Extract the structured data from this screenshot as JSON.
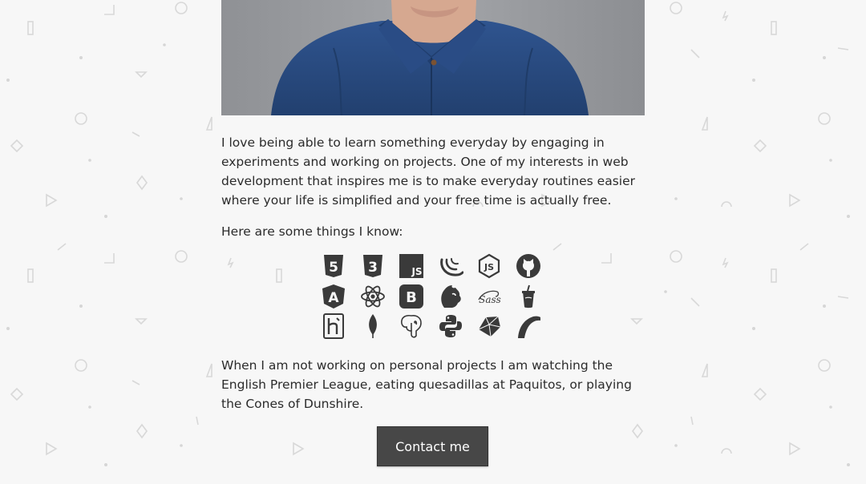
{
  "about": {
    "paragraph_1": "I love being able to learn something everyday by engaging in experiments and working on projects. One of my interests in web development that inspires me is to make everyday routines easier where your life is simplified and your free time is actually free.",
    "skills_intro": "Here are some things I know:",
    "paragraph_2": "When I am not working on personal projects I am watching the English Premier League, eating quesadillas at Paquitos, or playing the Cones of Dunshire."
  },
  "skills": [
    {
      "icon": "html5-icon"
    },
    {
      "icon": "css3-icon"
    },
    {
      "icon": "javascript-icon",
      "text": "JS"
    },
    {
      "icon": "jquery-icon"
    },
    {
      "icon": "nodejs-icon",
      "text": "JS"
    },
    {
      "icon": "github-icon"
    },
    {
      "icon": "angular-icon",
      "text": "A"
    },
    {
      "icon": "react-icon"
    },
    {
      "icon": "bootstrap-icon",
      "text": "B"
    },
    {
      "icon": "grunt-icon"
    },
    {
      "icon": "sass-icon",
      "text": "Sass"
    },
    {
      "icon": "gulp-icon"
    },
    {
      "icon": "heroku-icon"
    },
    {
      "icon": "mongodb-icon"
    },
    {
      "icon": "postgresql-icon"
    },
    {
      "icon": "python-icon"
    },
    {
      "icon": "ruby-icon"
    },
    {
      "icon": "rails-icon"
    }
  ],
  "contact_button": "Contact me",
  "colors": {
    "background": "#f7f7f7",
    "text": "#2b2b2b",
    "icon": "#3a3a3a",
    "button": "#474747",
    "button_text": "#ffffff",
    "shirt": "#2d4f8f"
  }
}
